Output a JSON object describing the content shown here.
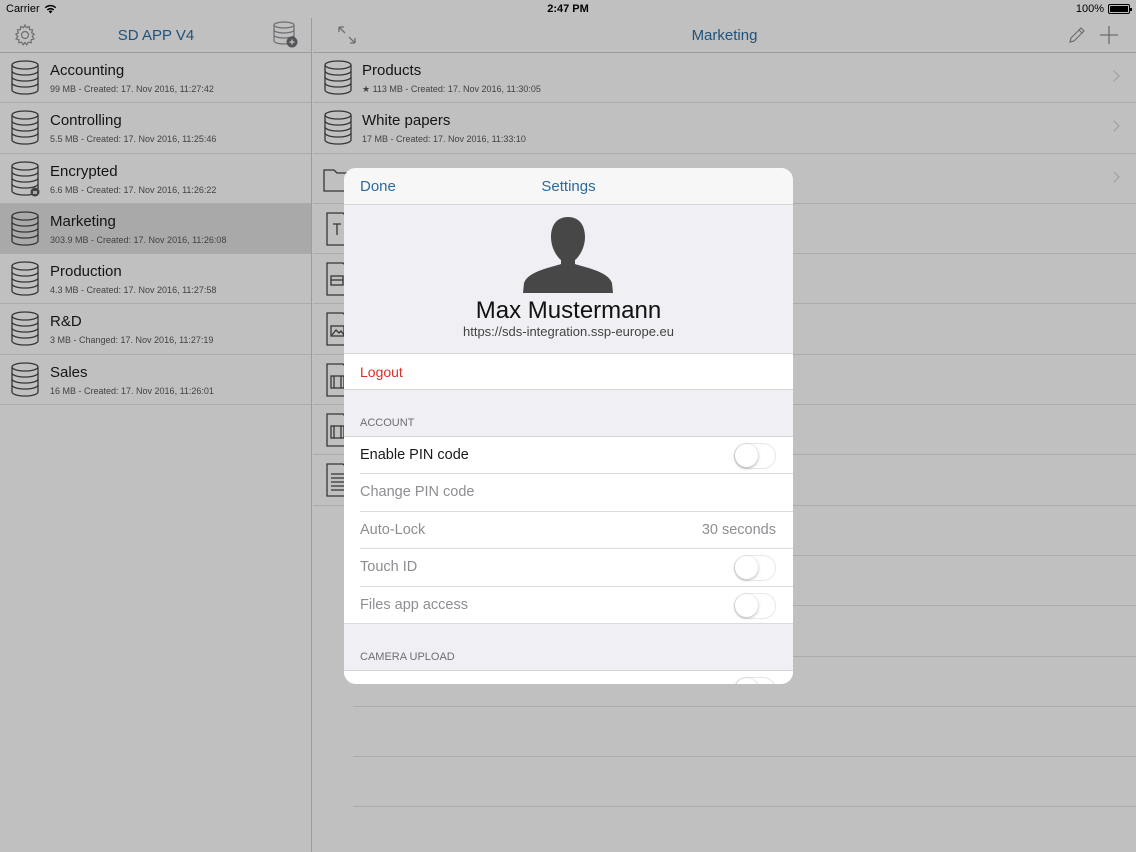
{
  "status_bar": {
    "carrier": "Carrier",
    "time": "2:47 PM",
    "battery": "100%"
  },
  "sidebar": {
    "title": "SD APP V4",
    "items": [
      {
        "name": "Accounting",
        "meta": "99 MB - Created: 17. Nov 2016, 11:27:42",
        "icon": "database-icon"
      },
      {
        "name": "Controlling",
        "meta": "5.5 MB - Created: 17. Nov 2016, 11:25:46",
        "icon": "database-icon"
      },
      {
        "name": "Encrypted",
        "meta": "6.6 MB - Created: 17. Nov 2016, 11:26:22",
        "icon": "encrypted-database-icon"
      },
      {
        "name": "Marketing",
        "meta": "303.9 MB - Created: 17. Nov 2016, 11:26:08",
        "icon": "database-icon",
        "selected": true
      },
      {
        "name": "Production",
        "meta": "4.3 MB - Created: 17. Nov 2016, 11:27:58",
        "icon": "database-icon"
      },
      {
        "name": "R&D",
        "meta": "3 MB - Changed: 17. Nov 2016, 11:27:19",
        "icon": "database-icon"
      },
      {
        "name": "Sales",
        "meta": "16 MB - Created: 17. Nov 2016, 11:26:01",
        "icon": "database-icon"
      }
    ]
  },
  "main": {
    "title": "Marketing",
    "items": [
      {
        "name": "Products",
        "meta": "★ 113 MB - Created: 17. Nov 2016, 11:30:05",
        "icon": "database-icon"
      },
      {
        "name": "White papers",
        "meta": "17 MB - Created: 17. Nov 2016, 11:33:10",
        "icon": "database-icon"
      }
    ]
  },
  "settings": {
    "done_label": "Done",
    "title": "Settings",
    "user_name": "Max Mustermann",
    "server_url": "https://sds-integration.ssp-europe.eu",
    "logout_label": "Logout",
    "account_header": "ACCOUNT",
    "account_rows": [
      {
        "label": "Enable PIN code",
        "type": "toggle",
        "on": false
      },
      {
        "label": "Change PIN code",
        "type": "text",
        "disabled": true
      },
      {
        "label": "Auto-Lock",
        "type": "value",
        "value": "30 seconds",
        "disabled": true
      },
      {
        "label": "Touch ID",
        "type": "toggle",
        "on": false,
        "disabled": true
      },
      {
        "label": "Files app access",
        "type": "toggle",
        "on": false,
        "disabled": true
      }
    ],
    "camera_header": "CAMERA UPLOAD"
  },
  "colors": {
    "accent": "#2a6a9f",
    "destructive": "#d9312b"
  }
}
